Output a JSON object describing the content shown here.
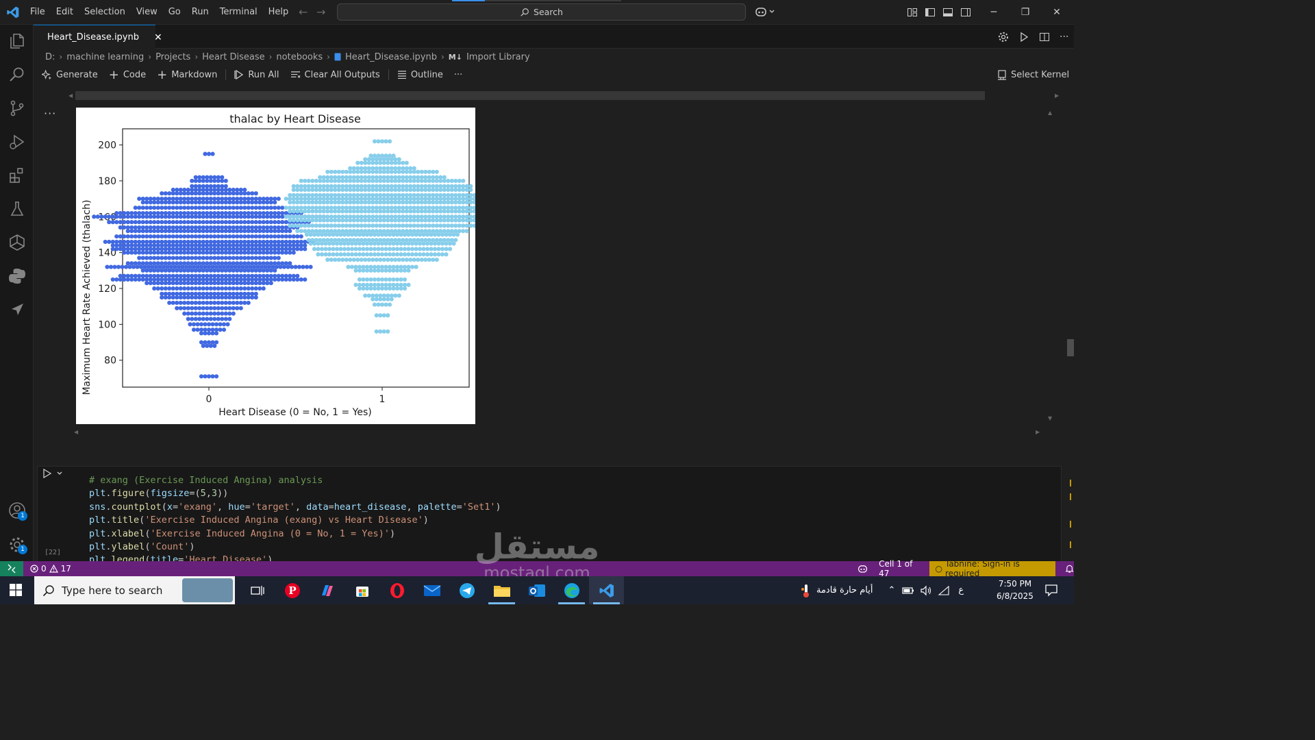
{
  "menu": [
    "File",
    "Edit",
    "Selection",
    "View",
    "Go",
    "Run",
    "Terminal",
    "Help"
  ],
  "search": {
    "label": "Search"
  },
  "tab": {
    "label": "Heart_Disease.ipynb"
  },
  "breadcrumb": [
    "D:",
    "machine learning",
    "Projects",
    "Heart Disease",
    "notebooks",
    "Heart_Disease.ipynb",
    "Import Library"
  ],
  "breadcrumb_md_prefix": "M↓",
  "toolbar": {
    "generate": "Generate",
    "code": "Code",
    "markdown": "Markdown",
    "run_all": "Run All",
    "clear": "Clear All Outputs",
    "outline": "Outline",
    "more": "···",
    "kernel": "Select Kernel"
  },
  "cell_more": "···",
  "chart_data": {
    "type": "scatter",
    "subtype": "swarm",
    "title": "thalac by Heart Disease",
    "xlabel": "Heart Disease (0 = No, 1 = Yes)",
    "ylabel": "Maximum Heart Rate Achieved (thalach)",
    "categories": [
      "0",
      "1"
    ],
    "yticks": [
      80,
      100,
      120,
      140,
      160,
      180,
      200
    ],
    "ylim": [
      65,
      209
    ],
    "colors": {
      "0": "#4169e1",
      "1": "#87ceeb"
    },
    "rows": {
      "0": [
        [
          71,
          5
        ],
        [
          88,
          4
        ],
        [
          90,
          5
        ],
        [
          95,
          5
        ],
        [
          97,
          9
        ],
        [
          100,
          11
        ],
        [
          103,
          12
        ],
        [
          106,
          14
        ],
        [
          109,
          18
        ],
        [
          112,
          22
        ],
        [
          115,
          26
        ],
        [
          117,
          26
        ],
        [
          120,
          30
        ],
        [
          123,
          34
        ],
        [
          125,
          52
        ],
        [
          127,
          48
        ],
        [
          130,
          36
        ],
        [
          132,
          55
        ],
        [
          134,
          44
        ],
        [
          137,
          38
        ],
        [
          140,
          46
        ],
        [
          142,
          52
        ],
        [
          144,
          52
        ],
        [
          146,
          56
        ],
        [
          149,
          50
        ],
        [
          152,
          44
        ],
        [
          154,
          48
        ],
        [
          157,
          54
        ],
        [
          160,
          62
        ],
        [
          162,
          50
        ],
        [
          165,
          40
        ],
        [
          168,
          36
        ],
        [
          170,
          38
        ],
        [
          173,
          26
        ],
        [
          175,
          20
        ],
        [
          177,
          10
        ],
        [
          180,
          10
        ],
        [
          182,
          8
        ],
        [
          195,
          3
        ]
      ],
      "1": [
        [
          96,
          4
        ],
        [
          105,
          4
        ],
        [
          111,
          5
        ],
        [
          114,
          6
        ],
        [
          116,
          10
        ],
        [
          120,
          13
        ],
        [
          122,
          15
        ],
        [
          125,
          13
        ],
        [
          130,
          15
        ],
        [
          132,
          19
        ],
        [
          136,
          30
        ],
        [
          139,
          35
        ],
        [
          142,
          37
        ],
        [
          145,
          39
        ],
        [
          147,
          40
        ],
        [
          150,
          41
        ],
        [
          152,
          46
        ],
        [
          155,
          50
        ],
        [
          158,
          50
        ],
        [
          160,
          52
        ],
        [
          163,
          50
        ],
        [
          165,
          52
        ],
        [
          168,
          50
        ],
        [
          170,
          52
        ],
        [
          172,
          50
        ],
        [
          175,
          48
        ],
        [
          177,
          48
        ],
        [
          180,
          44
        ],
        [
          182,
          34
        ],
        [
          185,
          30
        ],
        [
          187,
          18
        ],
        [
          190,
          14
        ],
        [
          192,
          10
        ],
        [
          194,
          7
        ],
        [
          202,
          5
        ]
      ]
    }
  },
  "code": {
    "exec_count": "[22]",
    "lines": [
      [
        [
          "c-com",
          "# exang (Exercise Induced Angina) analysis"
        ]
      ],
      [
        [
          "c-var",
          "plt"
        ],
        [
          "",
          "."
        ],
        [
          "c-fn",
          "figure"
        ],
        [
          "",
          "("
        ],
        [
          "c-var",
          "figsize"
        ],
        [
          "",
          "=("
        ],
        [
          "c-num",
          "5"
        ],
        [
          "",
          ","
        ],
        [
          "c-num",
          "3"
        ],
        [
          "",
          "))"
        ]
      ],
      [
        [
          "c-var",
          "sns"
        ],
        [
          "",
          "."
        ],
        [
          "c-fn",
          "countplot"
        ],
        [
          "",
          "("
        ],
        [
          "c-var",
          "x"
        ],
        [
          "",
          "="
        ],
        [
          "c-str",
          "'exang'"
        ],
        [
          "",
          ", "
        ],
        [
          "c-var",
          "hue"
        ],
        [
          "",
          "="
        ],
        [
          "c-str",
          "'target'"
        ],
        [
          "",
          ", "
        ],
        [
          "c-var",
          "data"
        ],
        [
          "",
          "="
        ],
        [
          "c-var",
          "heart_disease"
        ],
        [
          "",
          ", "
        ],
        [
          "c-var",
          "palette"
        ],
        [
          "",
          "="
        ],
        [
          "c-str",
          "'Set1'"
        ],
        [
          "",
          ")"
        ]
      ],
      [
        [
          "c-var",
          "plt"
        ],
        [
          "",
          "."
        ],
        [
          "c-fn",
          "title"
        ],
        [
          "",
          "("
        ],
        [
          "c-str",
          "'Exercise Induced Angina (exang) vs Heart Disease'"
        ],
        [
          "",
          ")"
        ]
      ],
      [
        [
          "c-var",
          "plt"
        ],
        [
          "",
          "."
        ],
        [
          "c-fn",
          "xlabel"
        ],
        [
          "",
          "("
        ],
        [
          "c-str",
          "'Exercise Induced Angina (0 = No, 1 = Yes)'"
        ],
        [
          "",
          ")"
        ]
      ],
      [
        [
          "c-var",
          "plt"
        ],
        [
          "",
          "."
        ],
        [
          "c-fn",
          "ylabel"
        ],
        [
          "",
          "("
        ],
        [
          "c-str",
          "'Count'"
        ],
        [
          "",
          ")"
        ]
      ],
      [
        [
          "c-var",
          "plt"
        ],
        [
          "",
          "."
        ],
        [
          "c-fn",
          "legend"
        ],
        [
          "",
          "("
        ],
        [
          "c-var",
          "title"
        ],
        [
          "",
          "="
        ],
        [
          "c-str",
          "'Heart Disease'"
        ],
        [
          "",
          ")"
        ]
      ]
    ]
  },
  "status": {
    "errors": "0",
    "warnings": "17",
    "cell": "Cell 1 of 47",
    "tabnine": "Tabnine: Sign-in is required"
  },
  "activity_badges": {
    "accounts": "1",
    "settings": "1"
  },
  "taskbar": {
    "search_placeholder": "Type here to search",
    "weather": "أيام حارة قادمة",
    "lang": "ع",
    "time": "7:50 PM",
    "date": "6/8/2025"
  },
  "watermark": {
    "logo": "مستقل",
    "url": "mostaql.com"
  }
}
